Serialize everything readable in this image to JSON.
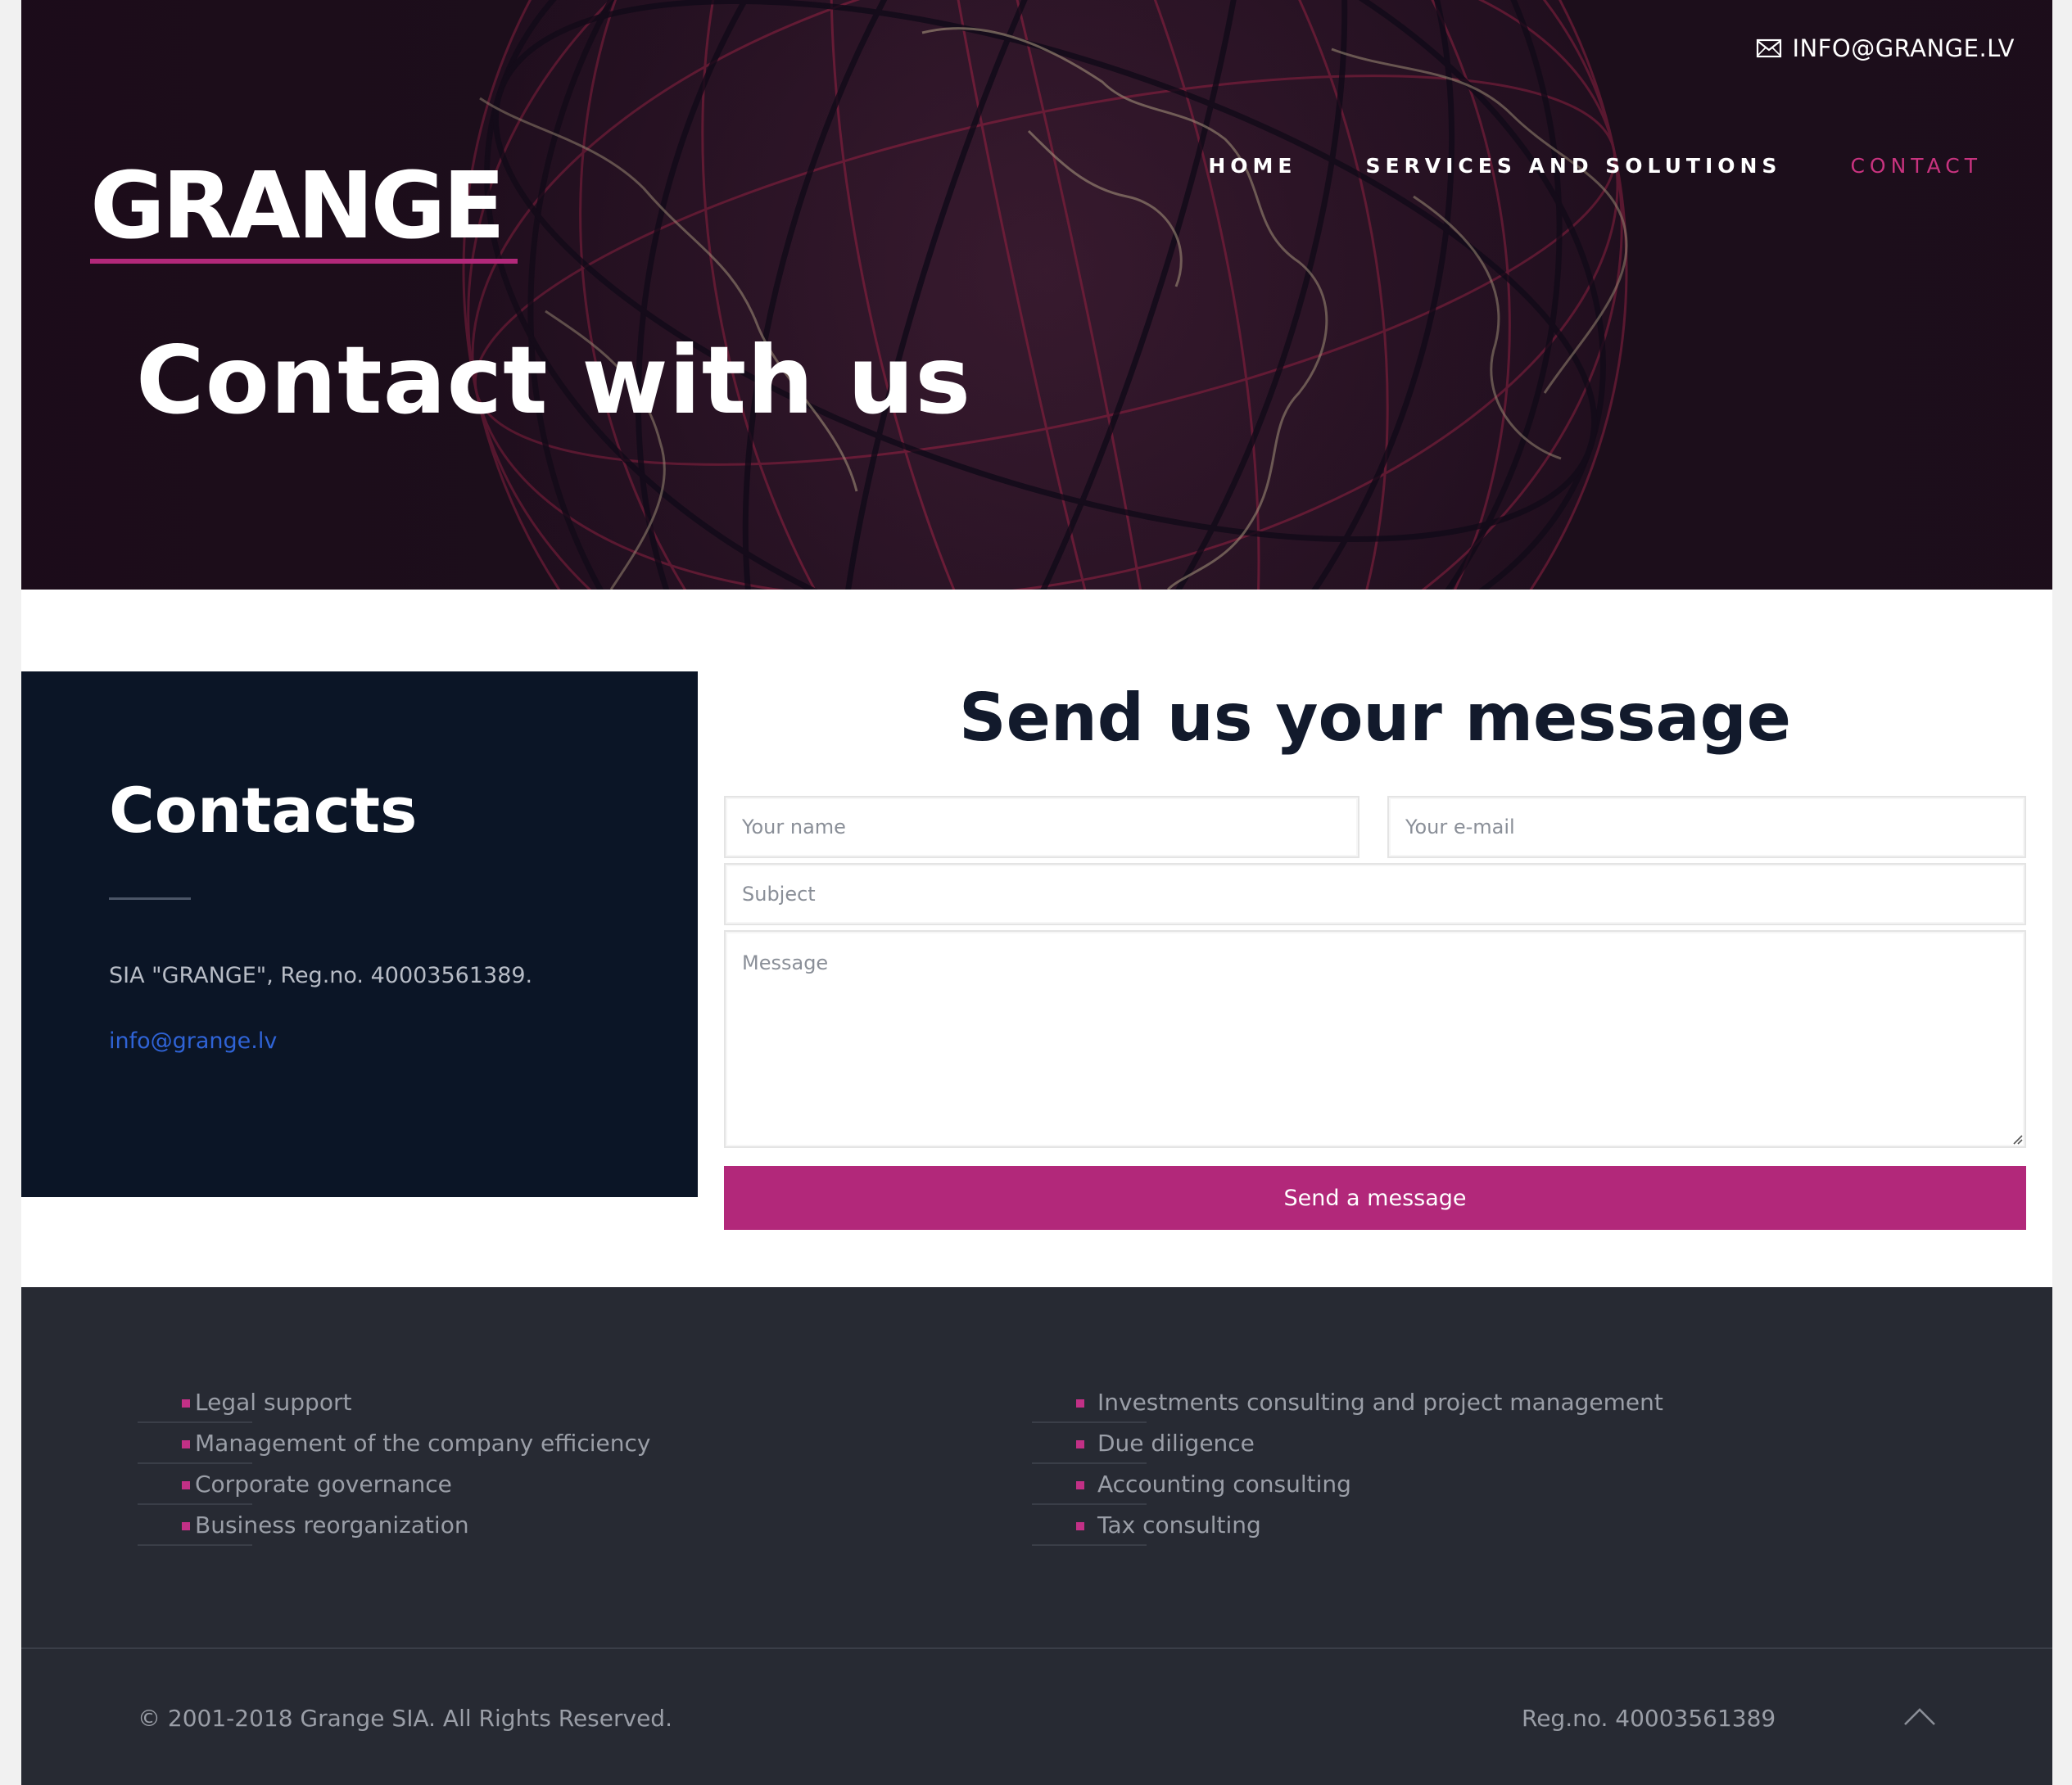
{
  "header": {
    "email": "INFO@GRANGE.LV",
    "logo": "GRANGE",
    "nav": [
      {
        "label": "HOME",
        "active": false
      },
      {
        "label": "SERVICES AND SOLUTIONS",
        "active": false
      },
      {
        "label": "CONTACT",
        "active": true
      }
    ],
    "title": "Contact with us"
  },
  "contacts": {
    "heading": "Contacts",
    "company": "SIA \"GRANGE\", Reg.no. 40003561389.",
    "email": "info@grange.lv"
  },
  "form": {
    "heading": "Send us your message",
    "name_placeholder": "Your name",
    "email_placeholder": "Your e-mail",
    "subject_placeholder": "Subject",
    "message_placeholder": "Message",
    "submit_label": "Send a message"
  },
  "footer": {
    "services_left": [
      "Legal support",
      "Management of the company efficiency",
      "Corporate governance",
      "Business reorganization"
    ],
    "services_right": [
      "Investments consulting and project management",
      "Due diligence",
      "Accounting consulting",
      "Tax consulting"
    ],
    "copyright": "© 2001-2018 Grange SIA. All Rights Reserved.",
    "reg": "Reg.no. 40003561389"
  },
  "colors": {
    "accent": "#b2287a",
    "hero_bg": "#1d0f1c",
    "contacts_bg": "#0b1526",
    "footer_bg": "#272a33",
    "link": "#2f63d6"
  },
  "icons": {
    "email": "envelope-icon",
    "back_to_top": "chevron-up-icon",
    "background": "globe-illustration"
  }
}
